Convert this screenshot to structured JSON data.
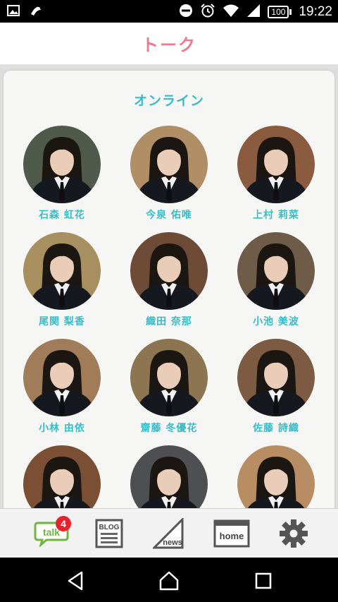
{
  "status_bar": {
    "time": "19:22",
    "battery": "100"
  },
  "header": {
    "title": "トーク"
  },
  "section": {
    "title": "オンライン"
  },
  "members": [
    {
      "name": "石森 虹花",
      "bg": "#4f5a4c"
    },
    {
      "name": "今泉 佑唯",
      "bg": "#b08e66"
    },
    {
      "name": "上村 莉菜",
      "bg": "#8a5b3e"
    },
    {
      "name": "尾関 梨香",
      "bg": "#a88f60"
    },
    {
      "name": "織田 奈那",
      "bg": "#6e4b36"
    },
    {
      "name": "小池 美波",
      "bg": "#6f5c48"
    },
    {
      "name": "小林 由依",
      "bg": "#a07d58"
    },
    {
      "name": "齋藤 冬優花",
      "bg": "#8d7552"
    },
    {
      "name": "佐藤 詩織",
      "bg": "#7d5a42"
    },
    {
      "name": "",
      "bg": "#7a4f33"
    },
    {
      "name": "",
      "bg": "#4d4f52"
    },
    {
      "name": "",
      "bg": "#b88d63"
    }
  ],
  "tabs": {
    "talk": {
      "label": "talk",
      "badge": "4"
    },
    "blog": {
      "label": "BLOG"
    },
    "news": {
      "label": "news"
    },
    "home": {
      "label": "home"
    }
  },
  "colors": {
    "accent": "#38bcc7",
    "title": "#ec7a8f",
    "badge": "#e8212f"
  }
}
